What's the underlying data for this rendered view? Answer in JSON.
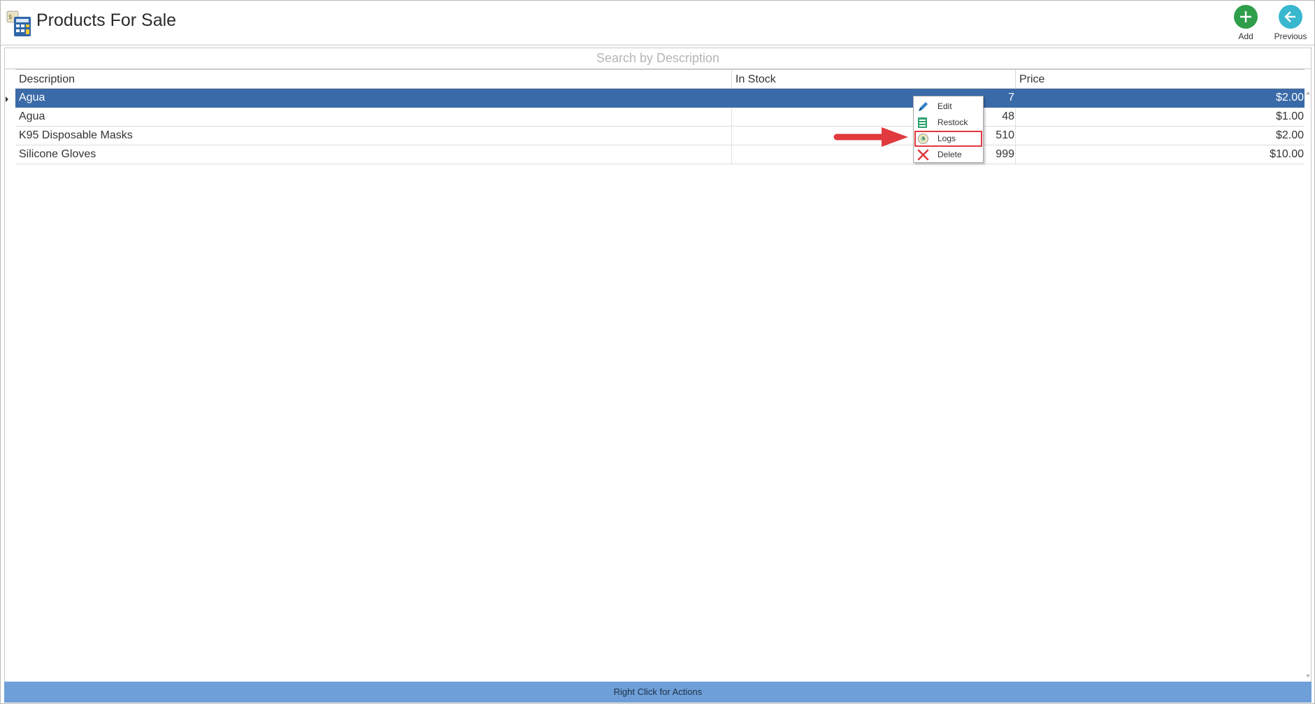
{
  "header": {
    "title": "Products For Sale",
    "add_label": "Add",
    "previous_label": "Previous"
  },
  "search": {
    "placeholder": "Search by Description",
    "value": ""
  },
  "grid": {
    "columns": [
      "Description",
      "In Stock",
      "Price"
    ],
    "rows": [
      {
        "description": "Agua",
        "in_stock": "7",
        "price": "$2.00",
        "selected": true
      },
      {
        "description": "Agua",
        "in_stock": "48",
        "price": "$1.00",
        "selected": false
      },
      {
        "description": "K95 Disposable Masks",
        "in_stock": "510",
        "price": "$2.00",
        "selected": false
      },
      {
        "description": "Silicone Gloves",
        "in_stock": "999",
        "price": "$10.00",
        "selected": false
      }
    ]
  },
  "context_menu": {
    "items": [
      {
        "label": "Edit",
        "icon": "pencil-icon"
      },
      {
        "label": "Restock",
        "icon": "restock-icon"
      },
      {
        "label": "Logs",
        "icon": "logs-icon",
        "highlighted": true
      },
      {
        "label": "Delete",
        "icon": "delete-x-icon"
      }
    ]
  },
  "status_bar": {
    "text": "Right Click for Actions"
  },
  "colors": {
    "selection": "#3a6aa8",
    "status_bar": "#6e9fd8",
    "add": "#2e9e4a",
    "previous": "#39b7cf",
    "highlight": "#e0393e"
  }
}
